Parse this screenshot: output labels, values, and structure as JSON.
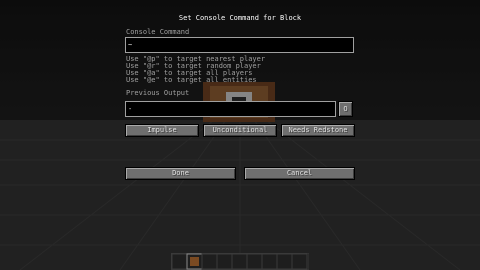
{
  "screen": {
    "title": "Set Console Command for Block"
  },
  "command": {
    "label": "Console Command",
    "value": "~",
    "hints": [
      "Use \"@p\" to target nearest player",
      "Use \"@r\" to target random player",
      "Use \"@a\" to target all players",
      "Use \"@e\" to target all entities"
    ]
  },
  "output": {
    "label": "Previous Output",
    "value": "-",
    "toggle_label": "O"
  },
  "mode_buttons": {
    "impulse": "Impulse",
    "unconditional": "Unconditional",
    "redstone": "Needs Redstone"
  },
  "actions": {
    "done": "Done",
    "cancel": "Cancel"
  },
  "colors": {
    "label_gray": "#a0a0a0",
    "title_white": "#ffffff",
    "button_fill": "#6f6f6f",
    "field_bg": "#000000"
  },
  "icons": {
    "background": "stone-floor-with-command-block",
    "hotbar": "hotbar-slots"
  }
}
